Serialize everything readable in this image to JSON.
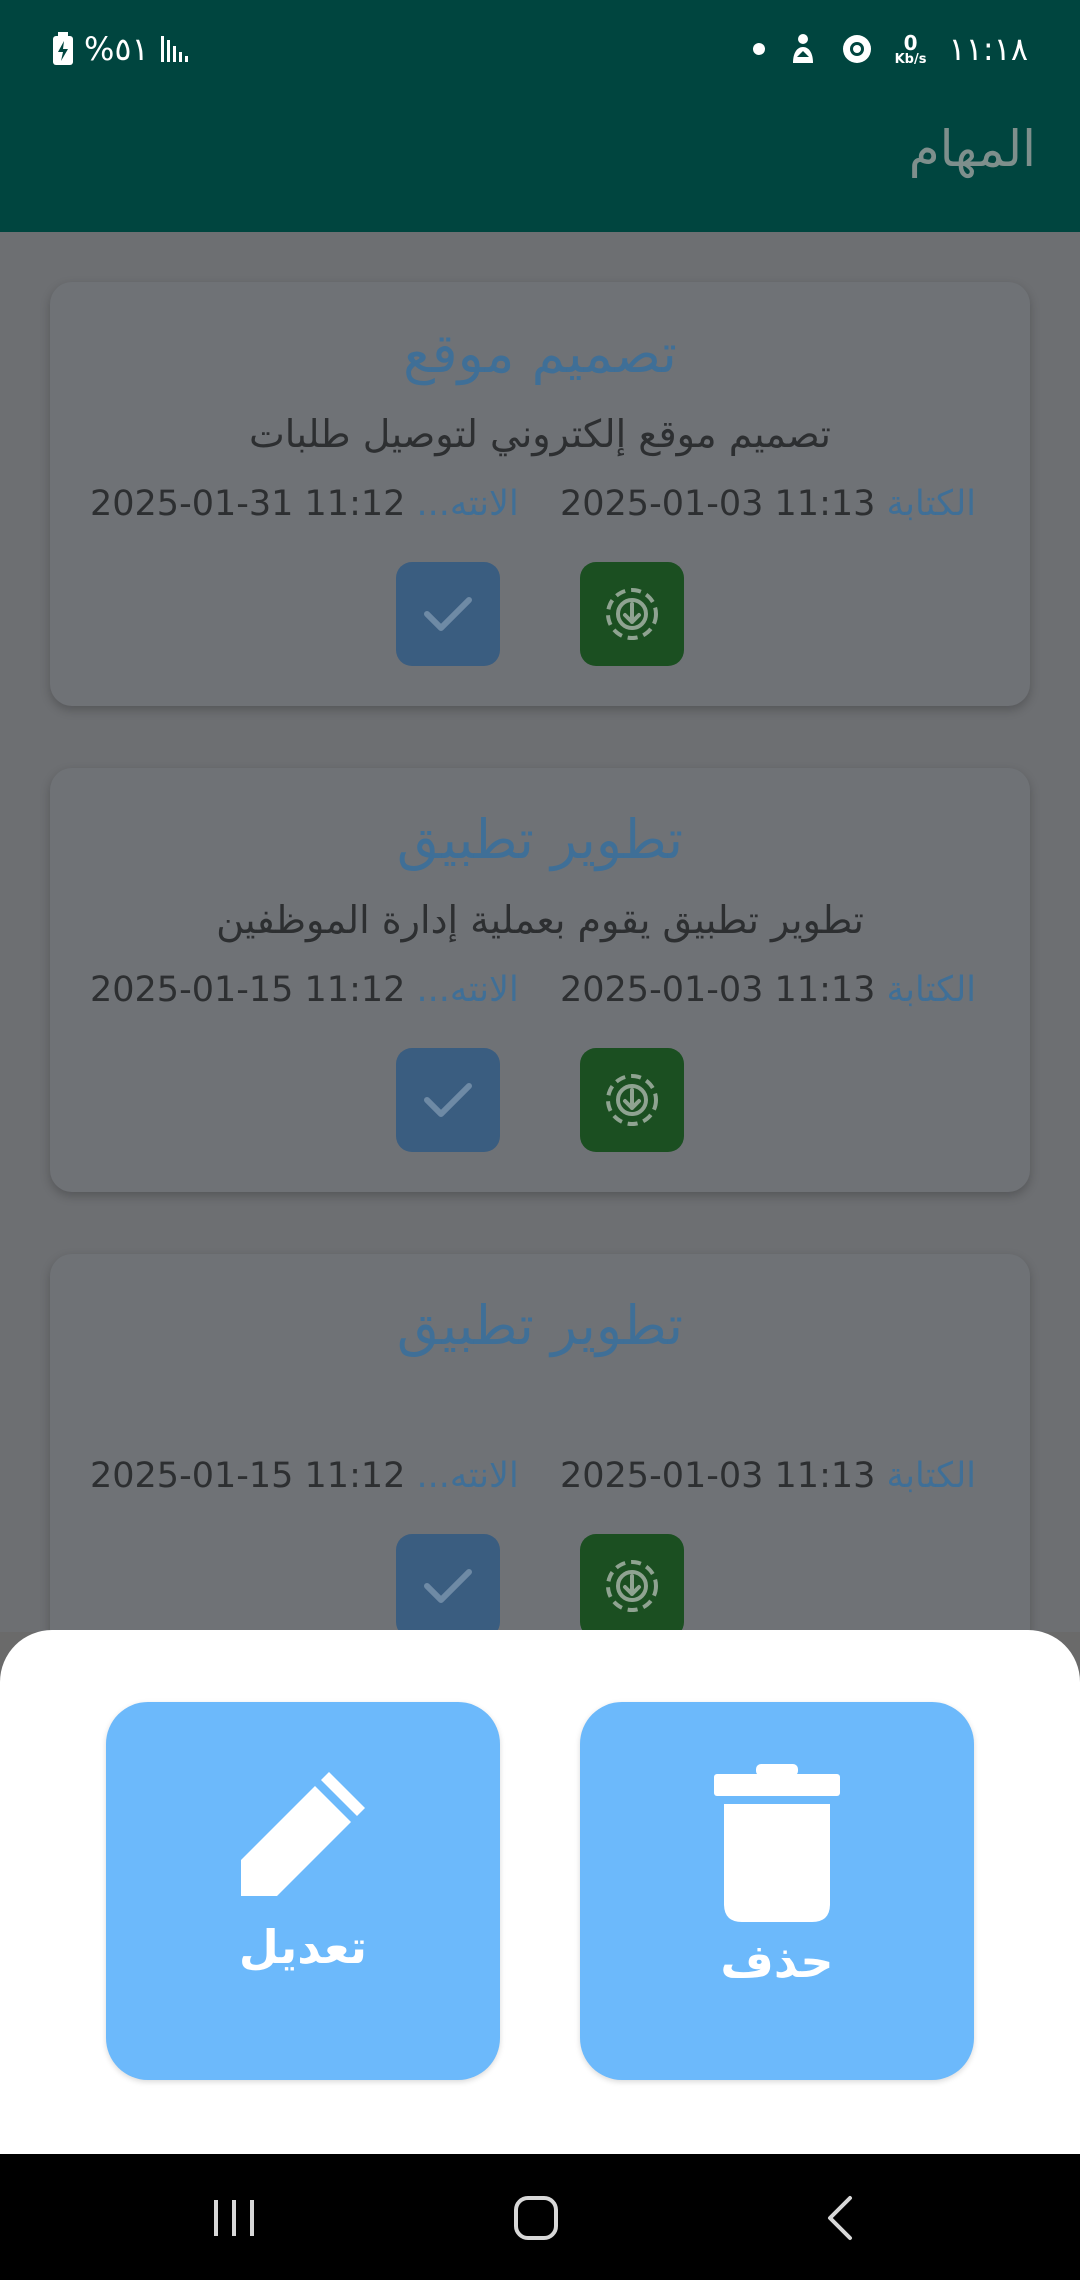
{
  "status_bar": {
    "time": "١١:١٨",
    "net_speed_value": "0",
    "net_speed_unit": "Kb/s",
    "battery_text": "%٥١"
  },
  "app_bar": {
    "title": "المهام"
  },
  "tasks": [
    {
      "title": "تصميم موقع",
      "description": "تصميم موقع إلكتروني لتوصيل طلبات",
      "written_label": "الكتابة",
      "written_value": "2025-01-03 11:13",
      "end_label": "الانته...",
      "end_value": "2025-01-31 11:12"
    },
    {
      "title": "تطوير تطبيق",
      "description": "تطوير تطبيق يقوم بعملية إدارة الموظفين",
      "written_label": "الكتابة",
      "written_value": "2025-01-03 11:13",
      "end_label": "الانته...",
      "end_value": "2025-01-15 11:12"
    },
    {
      "title": "تطوير تطبيق",
      "description": "",
      "written_label": "الكتابة",
      "written_value": "2025-01-03 11:13",
      "end_label": "الانته...",
      "end_value": "2025-01-15 11:12"
    }
  ],
  "bottom_sheet": {
    "edit_label": "تعديل",
    "delete_label": "حذف"
  },
  "icons": {
    "check": "check-icon",
    "download": "download-circle-icon",
    "edit": "pencil-icon",
    "delete": "trash-icon",
    "recents": "recents-icon",
    "home": "home-icon",
    "back": "back-icon"
  },
  "colors": {
    "app_bar": "#00453f",
    "action_button": "#6cb9fb",
    "check_button": "#3a5d80",
    "download_button": "#1b4f21",
    "title_text": "#3f6f97"
  }
}
